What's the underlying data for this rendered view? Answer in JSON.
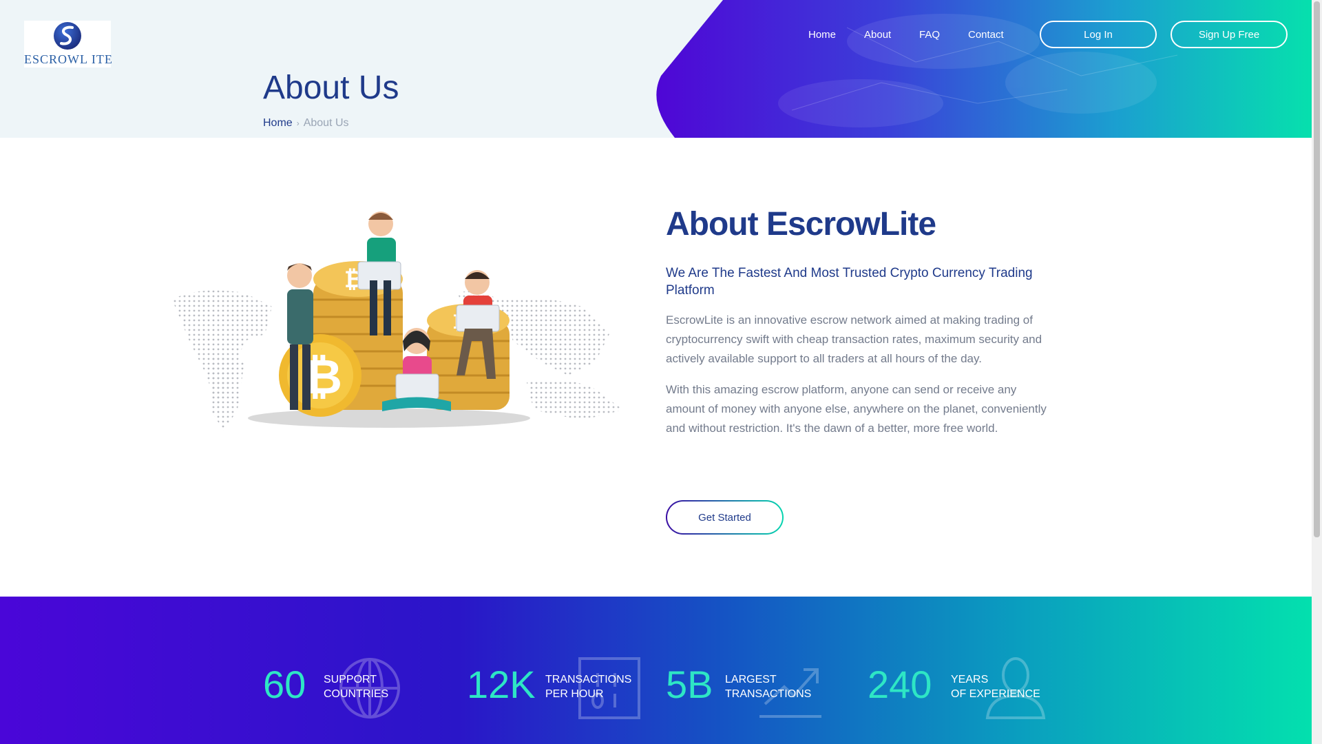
{
  "header": {
    "logo_text": "ESCROWL ITE",
    "nav": [
      "Home",
      "About",
      "FAQ",
      "Contact"
    ],
    "login_label": "Log In",
    "signup_label": "Sign Up Free",
    "page_title": "About Us",
    "breadcrumb": {
      "home": "Home",
      "separator": "›",
      "current": "About Us"
    }
  },
  "about": {
    "heading": "About EscrowLite",
    "subheading": "We Are The Fastest And Most Trusted Crypto Currency Trading Platform",
    "paragraph1": "EscrowLite is an innovative escrow network aimed at making trading of cryptocurrency swift with cheap transaction rates, maximum security and actively available support to all traders at all hours of the day.",
    "paragraph2": "With this amazing escrow platform, anyone can send or receive any amount of money with anyone else, anywhere on the planet, conveniently and without restriction. It's the dawn of a better, more free world.",
    "cta_label": "Get Started"
  },
  "stats": [
    {
      "value": "60",
      "label_line1": "SUPPORT",
      "label_line2": "COUNTRIES",
      "icon": "globe-icon"
    },
    {
      "value": "12K",
      "label_line1": "TRANSACTIONS",
      "label_line2": "PER HOUR",
      "icon": "binary-icon"
    },
    {
      "value": "5B",
      "label_line1": "LARGEST",
      "label_line2": "TRANSACTIONS",
      "icon": "chart-up-icon"
    },
    {
      "value": "240",
      "label_line1": "YEARS",
      "label_line2": "OF EXPERIENCE",
      "icon": "person-icon"
    }
  ],
  "colors": {
    "brand_navy": "#1f3a8a",
    "accent_teal": "#2ee6c5",
    "gradient_start": "#4a06d8",
    "gradient_end": "#03e0ae"
  }
}
